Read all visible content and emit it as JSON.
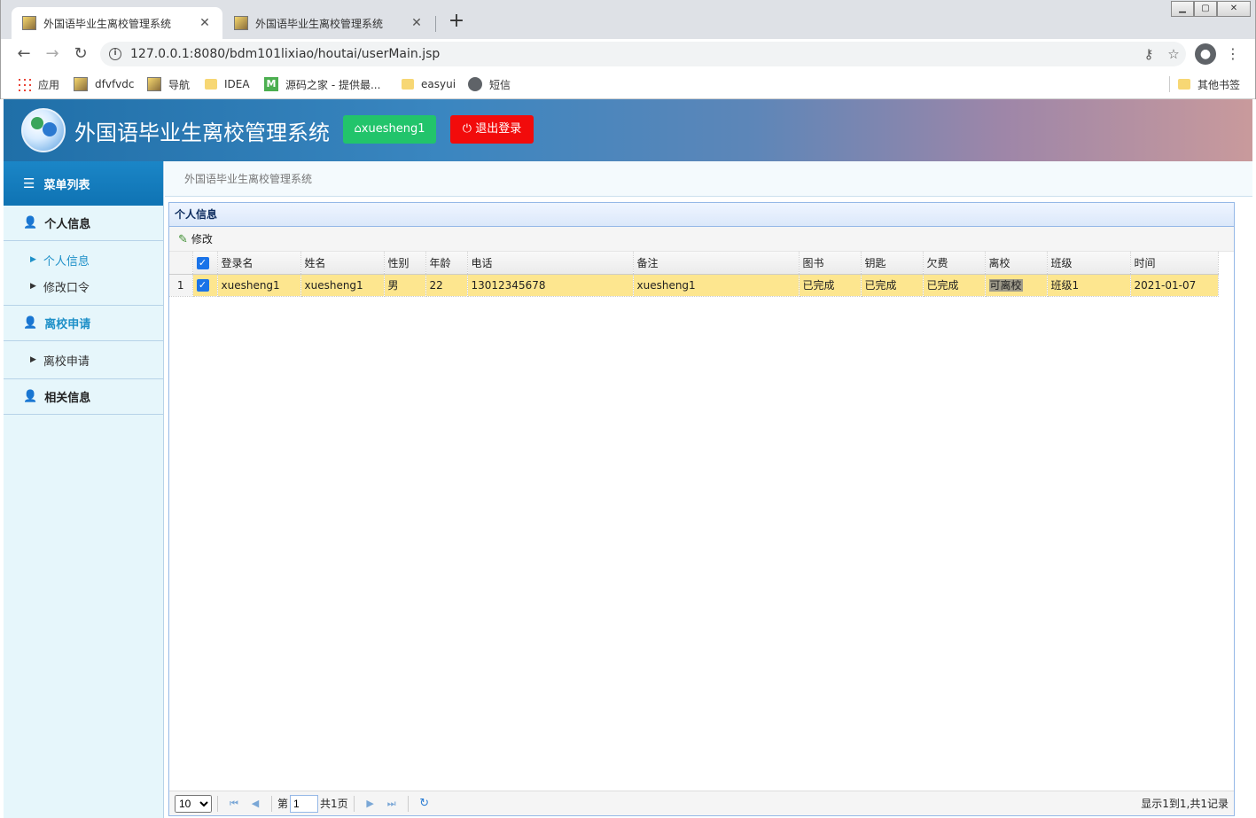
{
  "browser": {
    "tabs": [
      {
        "title": "外国语毕业生离校管理系统",
        "active": true
      },
      {
        "title": "外国语毕业生离校管理系统",
        "active": false
      }
    ],
    "url": "127.0.0.1:8080/bdm101lixiao/houtai/userMain.jsp",
    "bookmarks": [
      {
        "label": "应用",
        "icon": "apps-icon"
      },
      {
        "label": "dfvfvdc",
        "icon": "image-icon"
      },
      {
        "label": "导航",
        "icon": "image-icon"
      },
      {
        "label": "IDEA",
        "icon": "folder-icon"
      },
      {
        "label": "源码之家 - 提供最...",
        "icon": "m-site-icon"
      },
      {
        "label": "easyui",
        "icon": "folder-icon"
      },
      {
        "label": "短信",
        "icon": "globe-icon"
      }
    ],
    "other_bookmarks": "其他书签"
  },
  "header": {
    "title": "外国语毕业生离校管理系统",
    "user_button": "xuesheng1",
    "logout_button": "退出登录",
    "colors": {
      "user_button": "#22c46b",
      "logout_button": "#f20b0b"
    }
  },
  "sidebar": {
    "title": "菜单列表",
    "groups": [
      {
        "label": "个人信息",
        "items": [
          "个人信息",
          "修改口令"
        ]
      },
      {
        "label": "离校申请",
        "items": [
          "离校申请"
        ]
      },
      {
        "label": "相关信息",
        "items": []
      }
    ]
  },
  "breadcrumb": "外国语毕业生离校管理系统",
  "panel": {
    "title": "个人信息",
    "edit_button": "修改",
    "columns": [
      "登录名",
      "姓名",
      "性别",
      "年龄",
      "电话",
      "备注",
      "图书",
      "钥匙",
      "欠费",
      "离校",
      "班级",
      "时间"
    ],
    "rows": [
      {
        "num": "1",
        "cells": [
          "xuesheng1",
          "xuesheng1",
          "男",
          "22",
          "13012345678",
          "xuesheng1",
          "已完成",
          "已完成",
          "已完成",
          "可离校",
          "班级1",
          "2021-01-07"
        ]
      }
    ]
  },
  "pager": {
    "page_size": "10",
    "page_prefix": "第",
    "page_value": "1",
    "page_total": "共1页",
    "info": "显示1到1,共1记录"
  }
}
